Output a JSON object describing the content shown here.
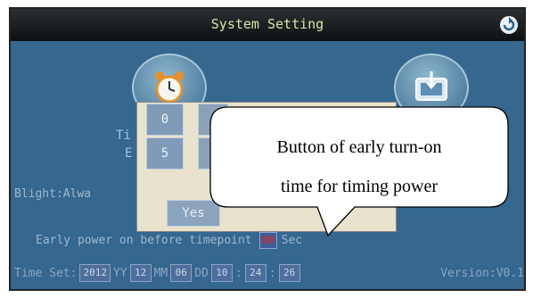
{
  "title": "System Setting",
  "icons": {
    "back": "back-arrow-icon",
    "alarm": "alarm-clock-icon",
    "monitor": "monitor-download-icon"
  },
  "left_label_line1": "Ti",
  "left_label_line2": "E",
  "popup": {
    "digits": [
      "0",
      "5"
    ],
    "yes_label": "Yes"
  },
  "blight": {
    "label": "Blight:",
    "value": "Alwa"
  },
  "early_power": {
    "label": "Early power on before timepoint",
    "value": "00",
    "unit": "Sec"
  },
  "time_set": {
    "label": "Time Set:",
    "year": "2012",
    "year_unit": "YY",
    "month": "12",
    "month_unit": "MM",
    "day": "06",
    "day_unit": "DD",
    "hour": "10",
    "minute": "24",
    "second": "26"
  },
  "version": "Version:V0.1",
  "callout": {
    "line1": "Button of early turn-on",
    "line2": "time for timing power"
  },
  "colors": {
    "screen": "#35678f",
    "popup": "#e9e2cc",
    "title": "#cde9a8",
    "early_value": "#c42e3a"
  }
}
